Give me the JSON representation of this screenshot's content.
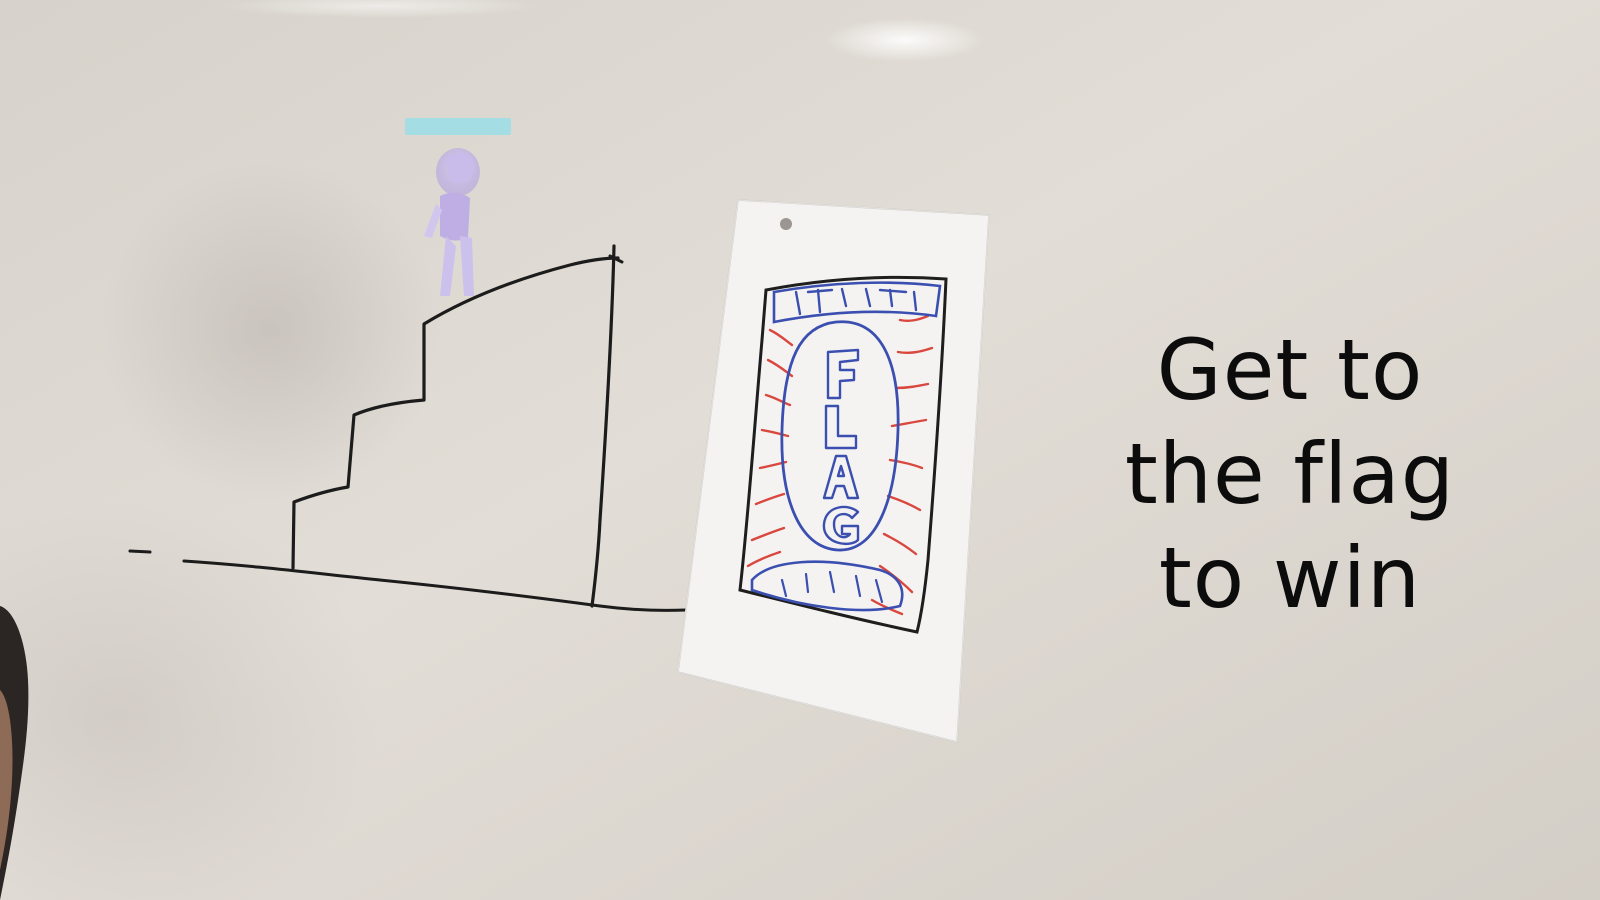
{
  "caption": {
    "line1": "Get to",
    "line2": "the flag",
    "line3": "to win"
  },
  "flag_paper": {
    "letters": [
      "F",
      "L",
      "A",
      "G"
    ]
  },
  "colors": {
    "whiteboard": "#dcd7cf",
    "marker_black": "#1c1c1c",
    "marker_blue": "#3b4fb0",
    "marker_red": "#d9473f",
    "projected_bar": "#9fdde6",
    "projected_character": "#b8a6e6"
  }
}
